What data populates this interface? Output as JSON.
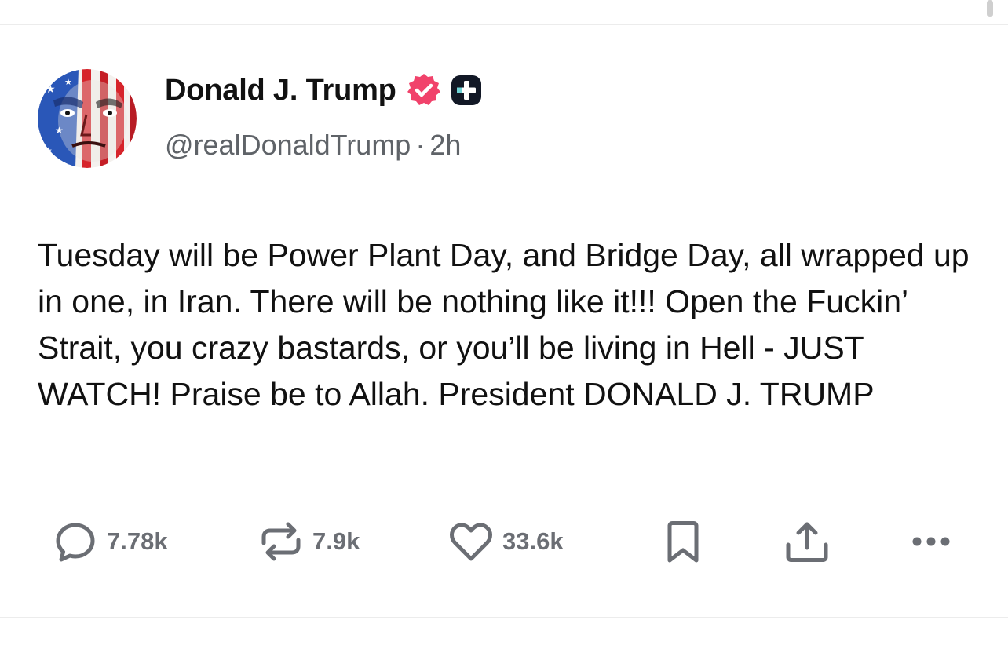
{
  "post": {
    "author": {
      "display_name": "Donald J. Trump",
      "handle": "@realDonaldTrump",
      "verified_icon": "verified-badge-icon",
      "badge_icon": "truth-plus-icon",
      "avatar": "profile-avatar"
    },
    "time_separator": "·",
    "timestamp": "2h",
    "body": "Tuesday will be Power Plant Day, and Bridge Day, all wrapped up in one, in Iran. There will be nothing like it!!! Open the Fuckin’ Strait, you crazy bastards, or you’ll be living in Hell - JUST WATCH! Praise be to Allah. President DONALD J. TRUMP"
  },
  "actions": {
    "replies": {
      "icon": "reply-icon",
      "count": "7.78k"
    },
    "retruths": {
      "icon": "retruth-icon",
      "count": "7.9k"
    },
    "likes": {
      "icon": "heart-icon",
      "count": "33.6k"
    },
    "bookmark": {
      "icon": "bookmark-icon"
    },
    "share": {
      "icon": "share-icon"
    },
    "more": {
      "icon": "more-icon"
    }
  },
  "colors": {
    "verified_badge": "#f1426b",
    "muted_text": "#5f6368",
    "action_gray": "#6b6e74",
    "body_text": "#111111"
  }
}
